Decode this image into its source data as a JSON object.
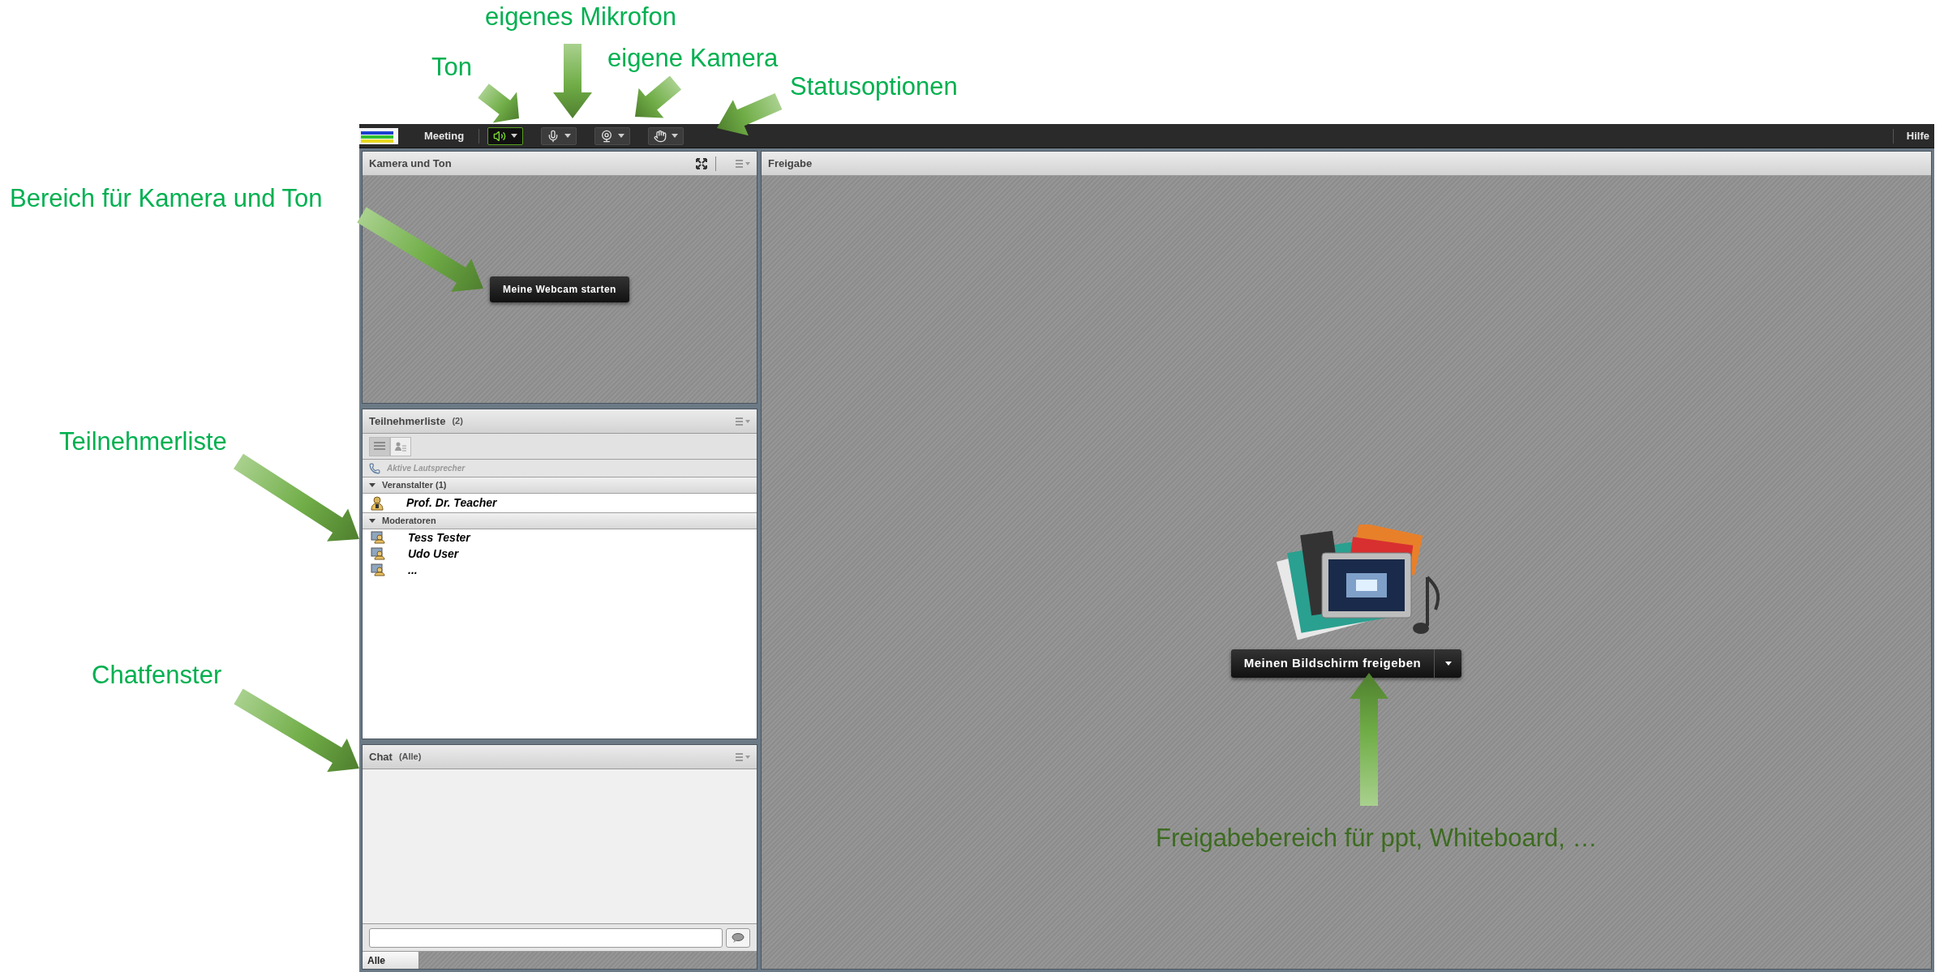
{
  "annotations": [
    {
      "text": "eigenes Mikrofon"
    },
    {
      "text": "Ton"
    },
    {
      "text": "eigene Kamera"
    },
    {
      "text": "Statusoptionen"
    },
    {
      "text": "Bereich für Kamera und Ton"
    },
    {
      "text": "Teilnehmerliste"
    },
    {
      "text": "Chatfenster"
    },
    {
      "text": "Freigabebereich für ppt, Whiteboard, …"
    }
  ],
  "menu_bar": {
    "menu": "Meeting",
    "toolbar": [
      {
        "kind": "speaker",
        "on": true
      },
      {
        "kind": "microphone",
        "on": false
      },
      {
        "kind": "camera",
        "on": false
      },
      {
        "kind": "status",
        "on": false
      }
    ],
    "help": "Hilfe"
  },
  "camera_pod": {
    "title": "Kamera und Ton",
    "button": "Meine Webcam starten"
  },
  "attendee_pod": {
    "title": "Teilnehmerliste",
    "count": "(2)",
    "views": [
      {
        "kind": "list",
        "selected": true
      },
      {
        "kind": "roles",
        "selected": false
      }
    ],
    "active_speakers": "Aktive Lautsprecher",
    "groups": [
      {
        "label": "Veranstalter (1)",
        "expanded": true,
        "kind": "host",
        "members": [
          "Prof. Dr. Teacher"
        ]
      },
      {
        "label": "Moderatoren",
        "expanded": true,
        "kind": "presenter",
        "members": [
          "Tess Tester",
          "Udo User",
          "..."
        ]
      }
    ]
  },
  "chat_pod": {
    "title": "Chat",
    "scope": "(Alle)",
    "tabs": [
      {
        "label": "Alle",
        "selected": true
      }
    ]
  },
  "share_pod": {
    "title": "Freigabe",
    "button": "Meinen Bildschirm freigeben"
  }
}
